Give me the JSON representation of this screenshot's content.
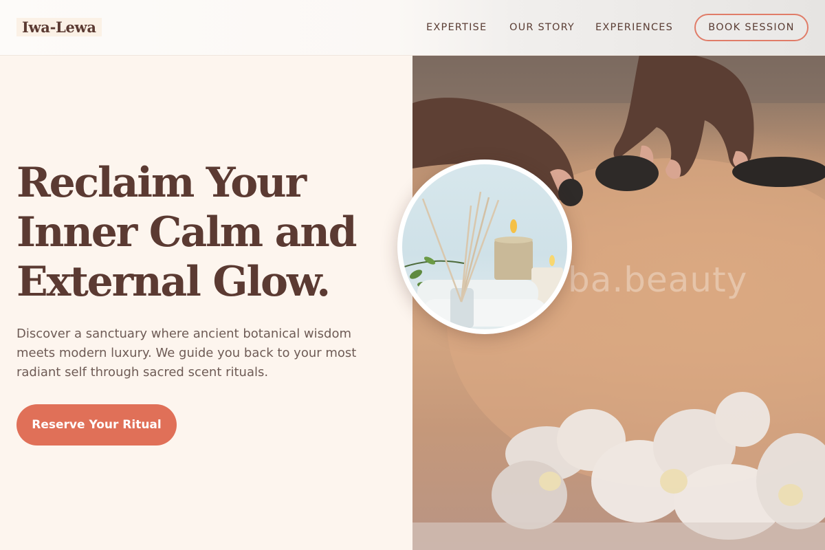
{
  "header": {
    "logo": "Iwa-Lewa",
    "nav": [
      "EXPERTISE",
      "OUR STORY",
      "EXPERIENCES"
    ],
    "cta": "BOOK SESSION"
  },
  "hero": {
    "headline": "Reclaim Your Inner Calm and External Glow.",
    "subcopy": "Discover a sanctuary where ancient botanical wisdom meets modern luxury. We guide you back to your most radiant self through sacred scent rituals.",
    "cta": "Reserve Your Ritual"
  },
  "images": {
    "hero_photo": {
      "label": "hot-stone-massage-photo",
      "watermark": "ba.beauty"
    },
    "inset_photo": {
      "label": "reed-diffuser-candles-photo"
    }
  },
  "colors": {
    "brand_brown": "#5b3a32",
    "accent_coral": "#e07058",
    "cream_bg": "#fdf5ee"
  }
}
